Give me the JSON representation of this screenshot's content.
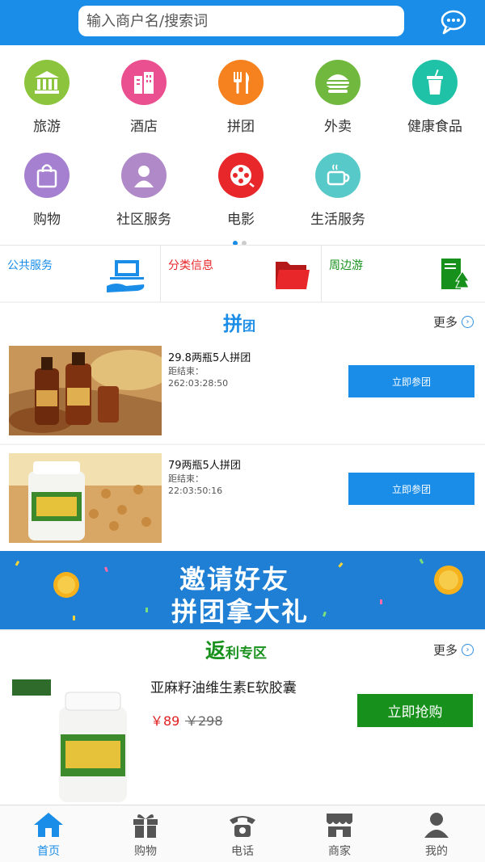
{
  "search": {
    "placeholder": "输入商户名/搜索词"
  },
  "header": {
    "chat_icon": "chat-bubble-icon"
  },
  "categories": [
    {
      "label": "旅游",
      "icon": "landmark-icon",
      "color": "#8cc43e"
    },
    {
      "label": "酒店",
      "icon": "hotel-icon",
      "color": "#ea4f8f"
    },
    {
      "label": "拼团",
      "icon": "fork-knife-icon",
      "color": "#f5821f"
    },
    {
      "label": "外卖",
      "icon": "burger-icon",
      "color": "#71b83f"
    },
    {
      "label": "健康食品",
      "icon": "drink-cup-icon",
      "color": "#1fc2a6"
    },
    {
      "label": "购物",
      "icon": "shopping-bag-icon",
      "color": "#a57fd0"
    },
    {
      "label": "社区服务",
      "icon": "person-icon",
      "color": "#b08ac8"
    },
    {
      "label": "电影",
      "icon": "film-reel-icon",
      "color": "#e8272a"
    },
    {
      "label": "生活服务",
      "icon": "coffee-cup-icon",
      "color": "#58c9c9"
    }
  ],
  "services": [
    {
      "label": "公共服务",
      "color": "#1a8de8",
      "icon": "hand-laptop-icon"
    },
    {
      "label": "分类信息",
      "color": "#e8272a",
      "icon": "folder-icon"
    },
    {
      "label": "周边游",
      "color": "#17911c",
      "icon": "document-tree-icon"
    }
  ],
  "group": {
    "title_big": "拼",
    "title_small": "团",
    "more": "更多",
    "deals": [
      {
        "name": "29.8两瓶5人拼团",
        "ends_label": "距结束：",
        "time": "262:03:28:50",
        "button": "立即参团"
      },
      {
        "name": "79两瓶5人拼团",
        "ends_label": "距结束：",
        "time": "22:03:50:16",
        "button": "立即参团"
      }
    ]
  },
  "banner": {
    "line1": "邀请好友",
    "line2": "拼团拿大礼"
  },
  "rebate": {
    "title_big": "返",
    "title_small": "利专区",
    "more": "更多",
    "product": {
      "name": "亚麻籽油维生素E软胶囊",
      "price": "￥89",
      "original_price": "￥298",
      "button": "立即抢购"
    }
  },
  "tabs": [
    {
      "label": "首页",
      "icon": "home-icon",
      "active": true
    },
    {
      "label": "购物",
      "icon": "gift-icon",
      "active": false
    },
    {
      "label": "电话",
      "icon": "telephone-icon",
      "active": false
    },
    {
      "label": "商家",
      "icon": "store-icon",
      "active": false
    },
    {
      "label": "我的",
      "icon": "user-icon",
      "active": false
    }
  ],
  "colors": {
    "brand": "#1a8de8",
    "active_tab": "#1a8de8",
    "buy_green": "#17911c",
    "price_red": "#e02020"
  }
}
